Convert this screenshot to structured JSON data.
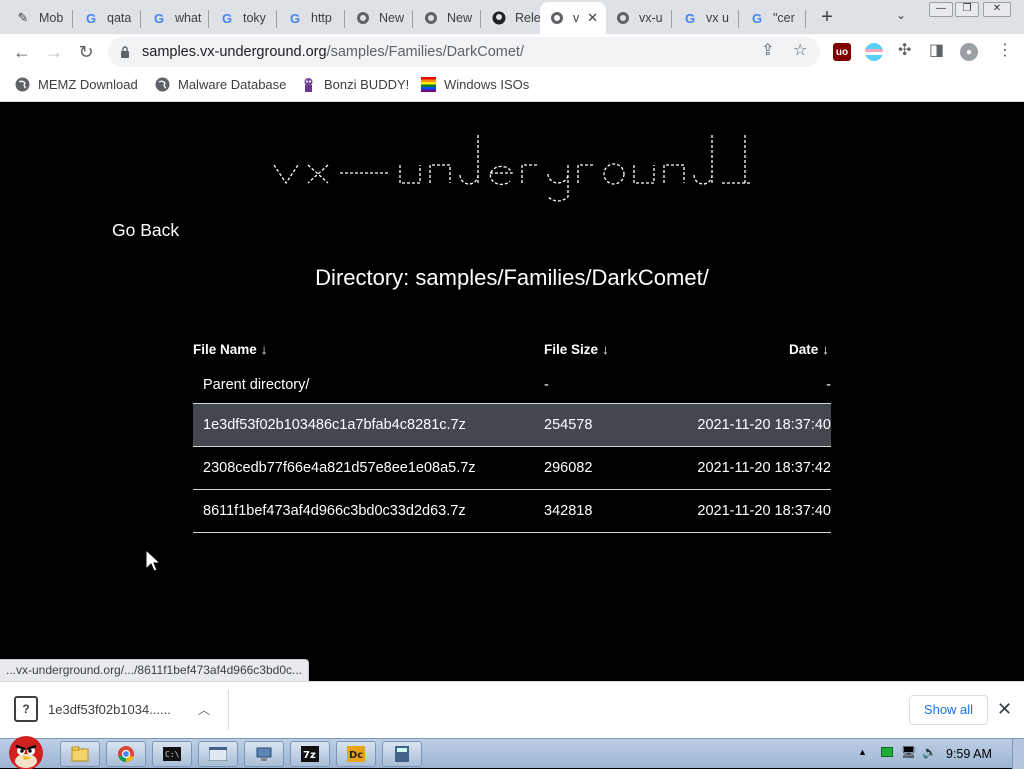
{
  "tabs": [
    {
      "title": "Mob",
      "icon": "pencil-icon"
    },
    {
      "title": "qata",
      "icon": "google-icon"
    },
    {
      "title": "what",
      "icon": "google-icon"
    },
    {
      "title": "toky",
      "icon": "google-icon"
    },
    {
      "title": "http",
      "icon": "google-icon"
    },
    {
      "title": "New",
      "icon": "globe-icon"
    },
    {
      "title": "New",
      "icon": "globe-icon"
    },
    {
      "title": "Rele",
      "icon": "github-icon"
    },
    {
      "title": "v",
      "icon": "globe-icon",
      "active": true
    },
    {
      "title": "vx-u",
      "icon": "globe-icon"
    },
    {
      "title": "vx u",
      "icon": "google-icon"
    },
    {
      "title": "\"cer",
      "icon": "google-icon"
    }
  ],
  "toolbar": {
    "url_host": "samples.vx-underground.org",
    "url_path": "/samples/Families/DarkComet/"
  },
  "bookmarks": [
    {
      "label": "MEMZ Download",
      "icon": "globe-icon"
    },
    {
      "label": "Malware Database",
      "icon": "globe-icon"
    },
    {
      "label": "Bonzi BUDDY!",
      "icon": "bonzi-icon"
    },
    {
      "label": "Windows ISOs",
      "icon": "windows-flag-icon"
    }
  ],
  "page": {
    "go_back": "Go Back",
    "directory_label": "Directory: samples/Families/DarkComet/",
    "headers": {
      "name": "File Name",
      "size": "File Size",
      "date": "Date",
      "arrow": "↓"
    },
    "parent": {
      "name": "Parent directory/",
      "size": "-",
      "date": "-"
    },
    "files": [
      {
        "name": "1e3df53f02b103486c1a7bfab4c8281c.7z",
        "size": "254578",
        "date": "2021-11-20 18:37:40"
      },
      {
        "name": "2308cedb77f66e4a821d57e8ee1e08a5.7z",
        "size": "296082",
        "date": "2021-11-20 18:37:42"
      },
      {
        "name": "8611f1bef473af4d966c3bd0c33d2d63.7z",
        "size": "342818",
        "date": "2021-11-20 18:37:40"
      }
    ]
  },
  "status_url": "...vx-underground.org/.../8611f1bef473af4d966c3bd0c...",
  "download": {
    "filename": "1e3df53f02b1034......",
    "show_all": "Show all"
  },
  "taskbar": {
    "clock": "9:59 AM"
  },
  "colors": {
    "page_bg": "#000000",
    "highlight_row": "#434750",
    "link_blue": "#1a73e8"
  }
}
